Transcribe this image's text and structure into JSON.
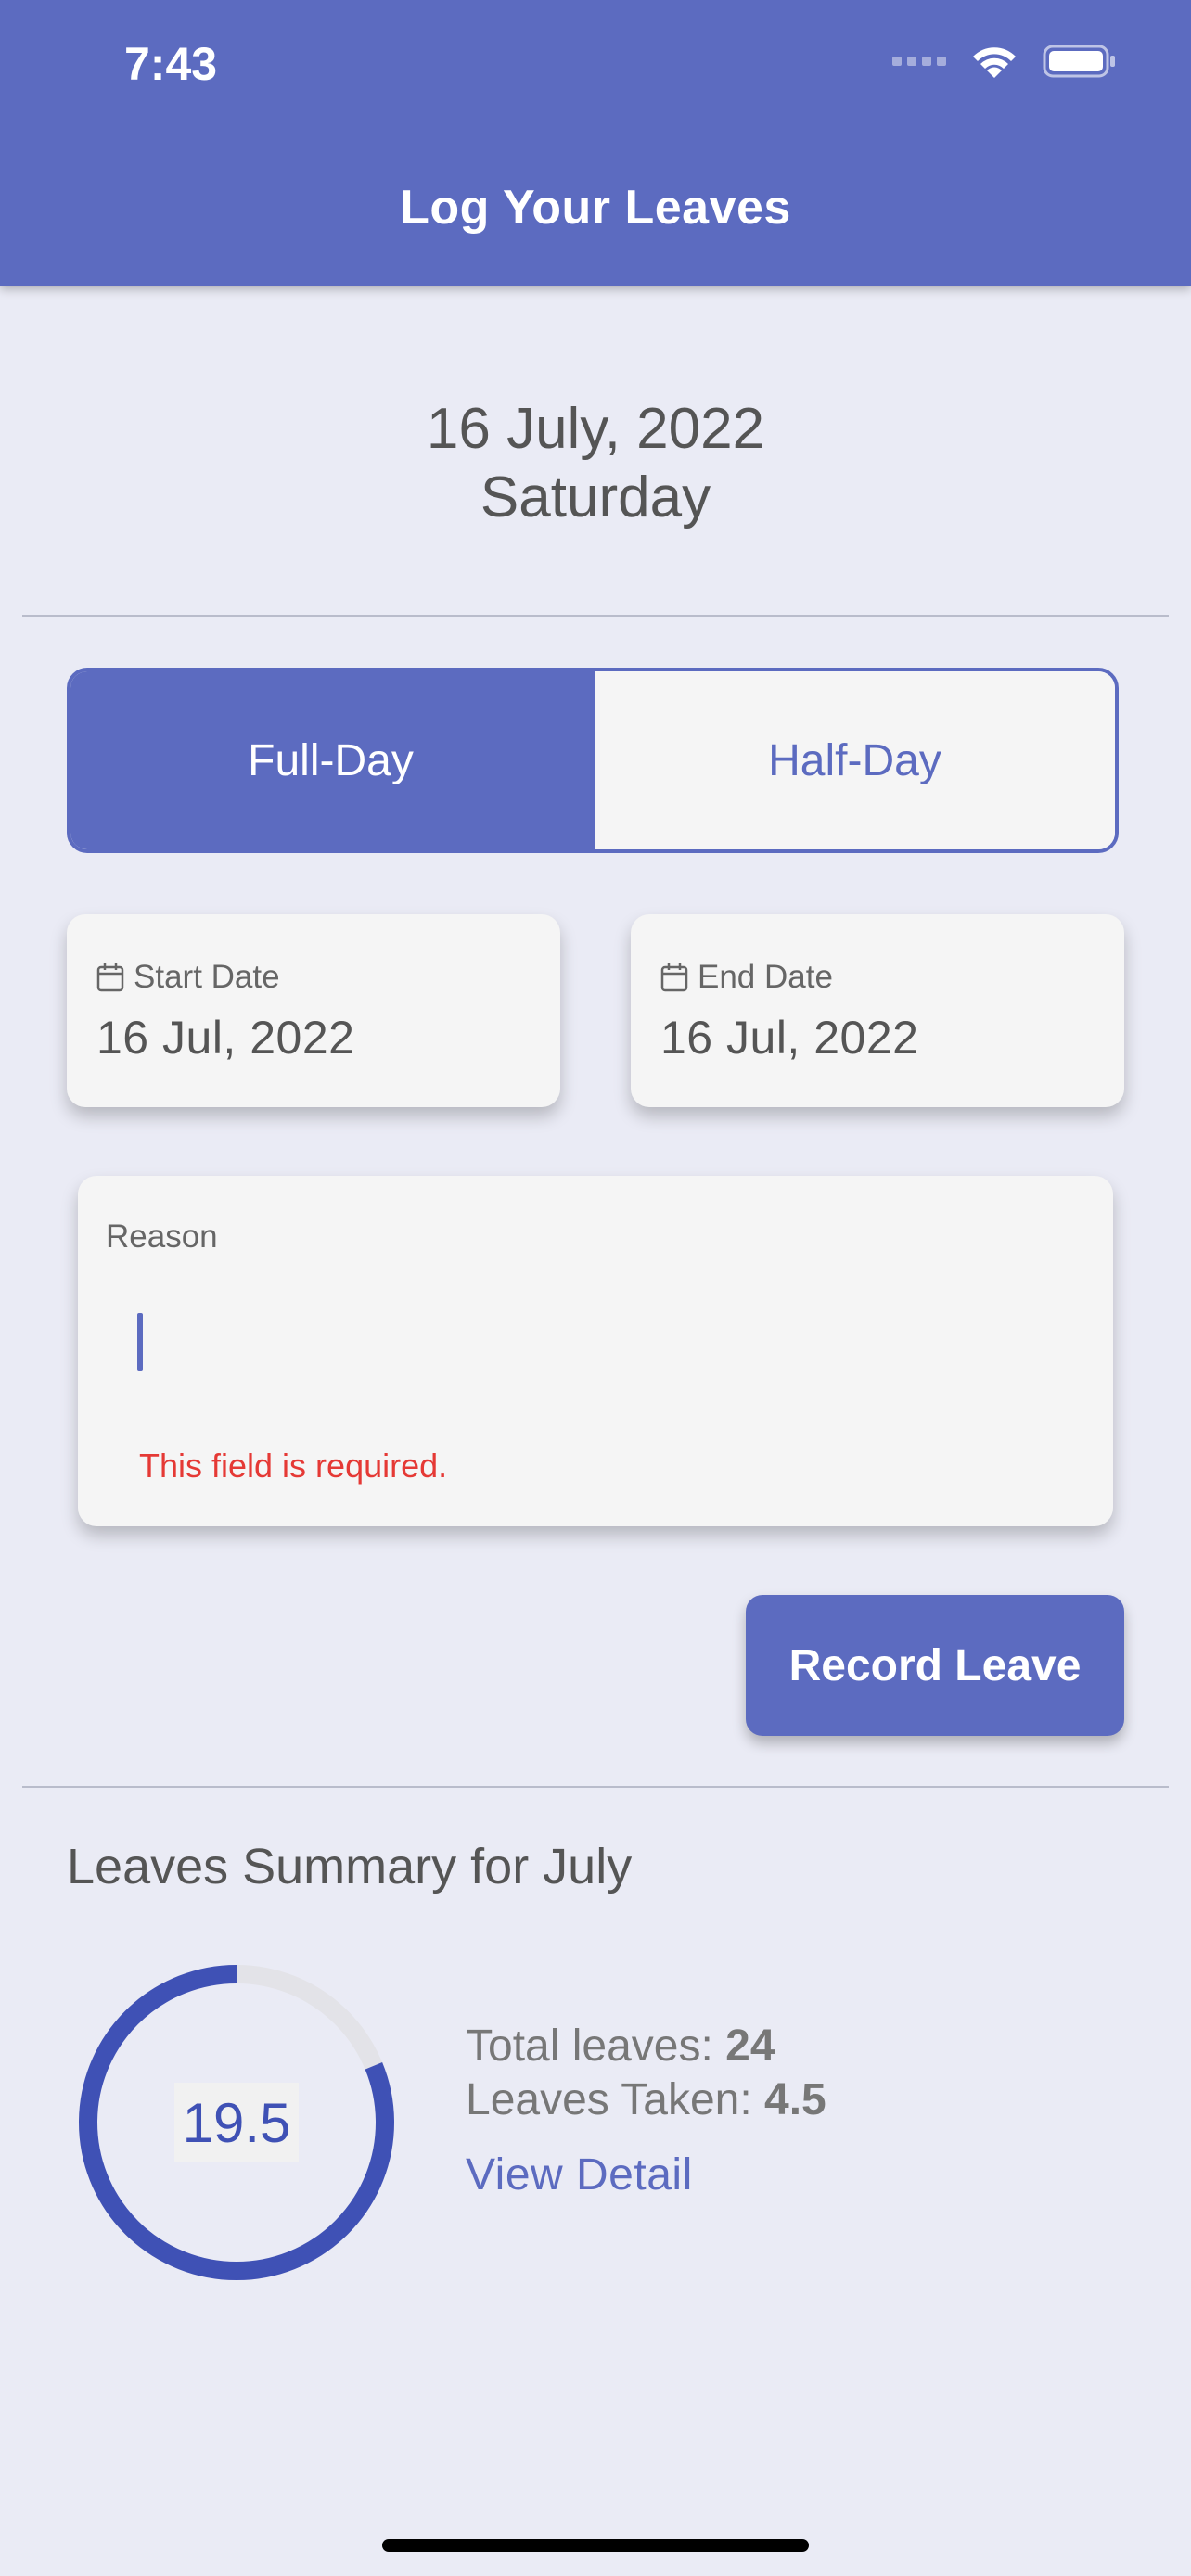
{
  "status_bar": {
    "time": "7:43"
  },
  "app_bar": {
    "title": "Log Your Leaves"
  },
  "header_date": {
    "date": "16 July, 2022",
    "weekday": "Saturday"
  },
  "leave_type": {
    "options": [
      "Full-Day",
      "Half-Day"
    ],
    "selected": "Full-Day"
  },
  "start_date": {
    "label": "Start Date",
    "value": "16 Jul, 2022"
  },
  "end_date": {
    "label": "End Date",
    "value": "16 Jul, 2022"
  },
  "reason": {
    "label": "Reason",
    "value": "",
    "error": "This field is required."
  },
  "record_button": {
    "label": "Record Leave"
  },
  "summary": {
    "title": "Leaves Summary for July",
    "remaining": "19.5",
    "total_label": "Total leaves:",
    "total_value": "24",
    "taken_label": "Leaves Taken:",
    "taken_value": "4.5",
    "taken_fraction": 0.1875,
    "view_detail": "View Detail"
  },
  "colors": {
    "primary": "#5c6bc0",
    "ring": "#3f51b5",
    "error": "#e53935",
    "background": "#eaebf5"
  }
}
